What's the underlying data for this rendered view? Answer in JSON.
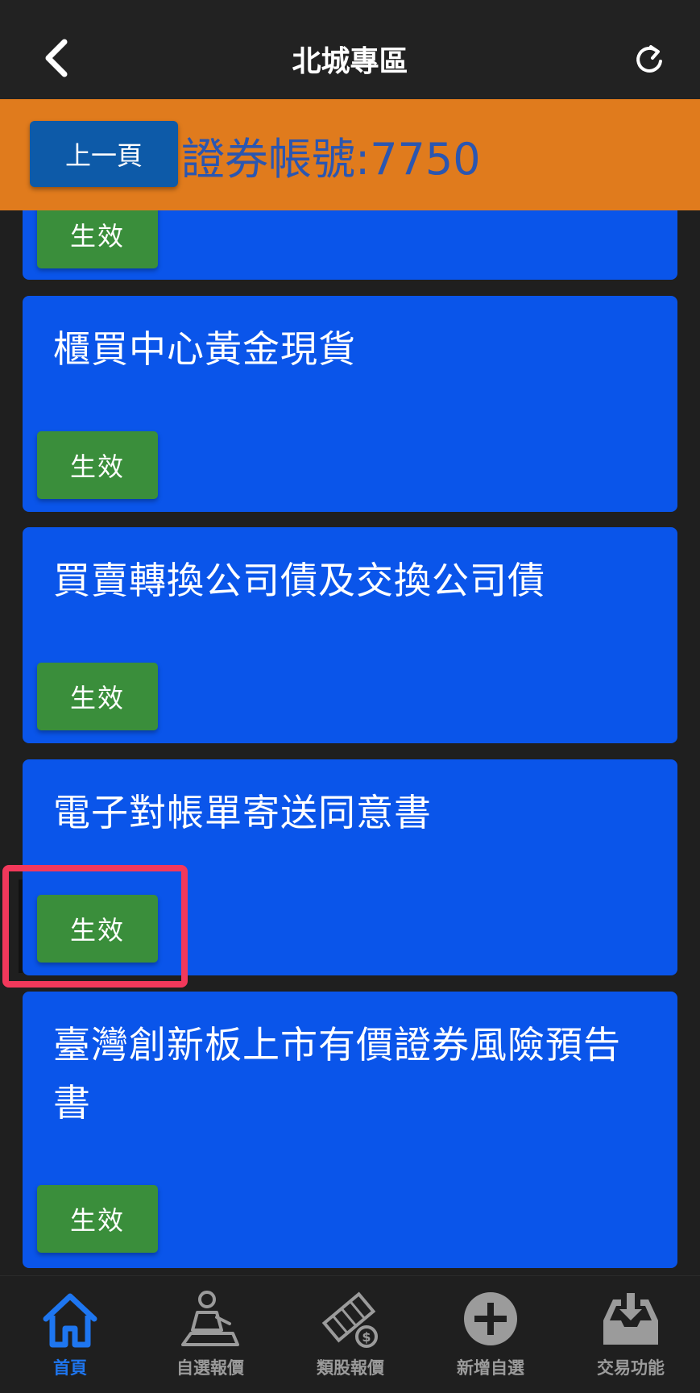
{
  "header": {
    "title": "北城專區"
  },
  "account": {
    "prev_label": "上一頁",
    "account_text": "證券帳號:7750"
  },
  "cards": [
    {
      "title": "",
      "button": "生效"
    },
    {
      "title": "櫃買中心黃金現貨",
      "button": "生效"
    },
    {
      "title": "買賣轉換公司債及交換公司債",
      "button": "生效"
    },
    {
      "title": "電子對帳單寄送同意書",
      "button": "生效"
    },
    {
      "title": "臺灣創新板上市有價證券風險預告書",
      "button": "生效"
    }
  ],
  "nav": {
    "items": [
      {
        "label": "首頁",
        "icon": "home-icon",
        "active": true
      },
      {
        "label": "自選報價",
        "icon": "person-at-desk-icon",
        "active": false
      },
      {
        "label": "類股報價",
        "icon": "film-coin-icon",
        "active": false
      },
      {
        "label": "新增自選",
        "icon": "plus-circle-icon",
        "active": false
      },
      {
        "label": "交易功能",
        "icon": "download-tray-icon",
        "active": false
      }
    ]
  },
  "colors": {
    "accent_orange": "#e07b1d",
    "card_blue": "#0a55ea",
    "button_green": "#3a8e3b",
    "highlight_red": "#f2385b",
    "active_nav": "#1e76f0"
  }
}
